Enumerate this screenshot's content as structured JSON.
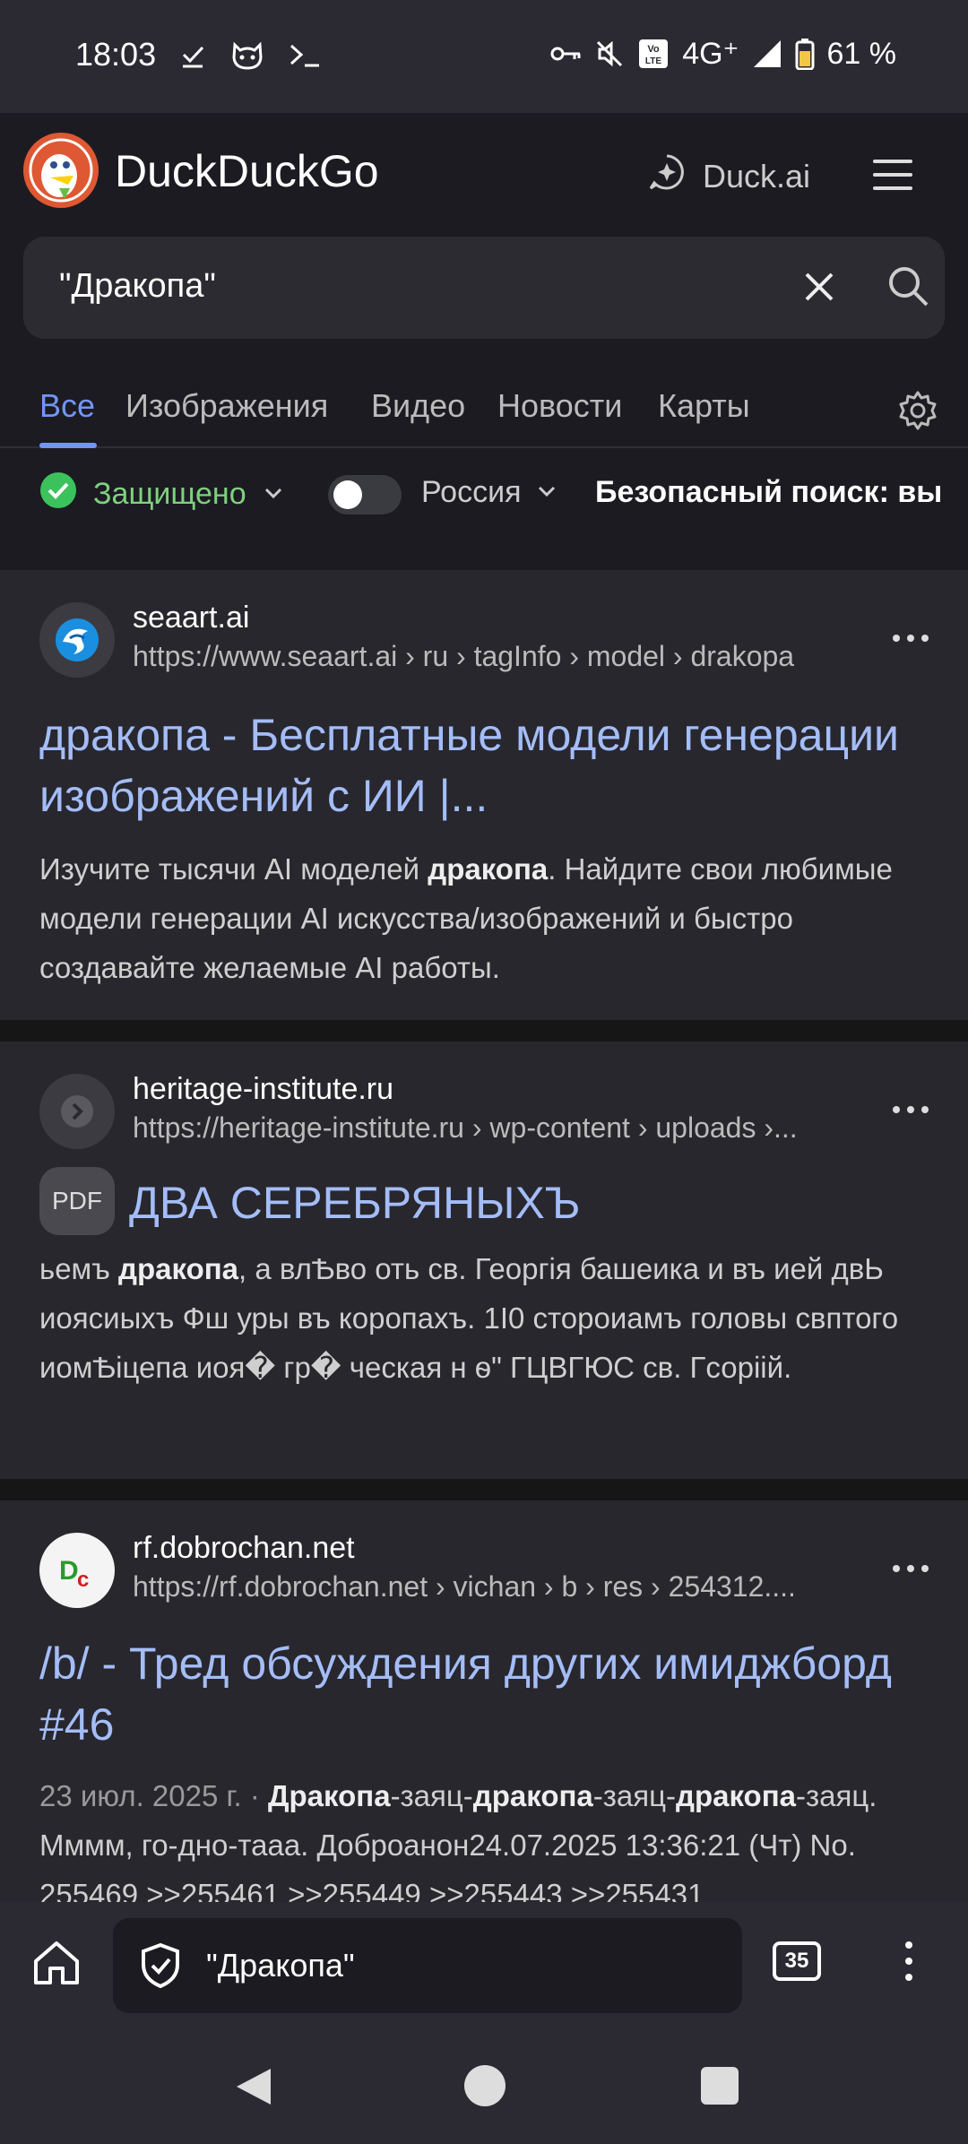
{
  "status_bar": {
    "time": "18:03",
    "network": "4G⁺",
    "battery": "61 %"
  },
  "header": {
    "brand": "DuckDuckGo",
    "duck_ai_label": "Duck.ai",
    "search_query": "\"Дракопа\""
  },
  "tabs": [
    {
      "label": "Все",
      "active": true
    },
    {
      "label": "Изображения"
    },
    {
      "label": "Видео"
    },
    {
      "label": "Новости"
    },
    {
      "label": "Карты"
    }
  ],
  "filters": {
    "protected_label": "Защищено",
    "region_label": "Россия",
    "safe_search_label": "Безопасный поиск: вы"
  },
  "results": [
    {
      "domain": "seaart.ai",
      "url": "https://www.seaart.ai › ru › tagInfo › model › drakopa",
      "title": "дракопа - Бесплатные модели генерации изображений с ИИ |...",
      "snippet_parts": [
        {
          "text": "Изучите тысячи AI моделей ",
          "bold": false
        },
        {
          "text": "дракопа",
          "bold": true
        },
        {
          "text": ". Найдите свои любимые модели генерации AI искусства/изображений и быстро создавайте желаемые AI работы.",
          "bold": false
        }
      ]
    },
    {
      "domain": "heritage-institute.ru",
      "url": "https://heritage-institute.ru › wp-content › uploads ›...",
      "badge": "PDF",
      "title": "ДВА СЕРЕБРЯНЫХЪ",
      "snippet_parts": [
        {
          "text": "ьемъ ",
          "bold": false
        },
        {
          "text": "дракопа",
          "bold": true
        },
        {
          "text": ", а влѢво оть св. Георгія башеика и въ ией двЬ иоясиыхъ Фш уры въ коропахъ. 1І0 стороиамъ головы свптого иомѢіцепа иоя� гр� ческая н ѳ\" ГЦВГЮС св. Гсоріій.",
          "bold": false
        }
      ]
    },
    {
      "domain": "rf.dobrochan.net",
      "url": "https://rf.dobrochan.net › vichan › b › res › 254312....",
      "title": "/b/ - Тред обсуждения других имиджборд #46",
      "date": "23 июл. 2025 г. · ",
      "snippet_parts": [
        {
          "text": "Дракопа",
          "bold": true
        },
        {
          "text": "-заяц-",
          "bold": false
        },
        {
          "text": "дракопа",
          "bold": true
        },
        {
          "text": "-заяц-",
          "bold": false
        },
        {
          "text": "дракопа",
          "bold": true
        },
        {
          "text": "-заяц. Мммм, го-дно-тааа. Доброанон24.07.2025 13:36:21 (Чт) No. 255469 >>255461 >>255449 >>255443 >>255431",
          "bold": false
        }
      ]
    }
  ],
  "bottom_bar": {
    "address_text": "\"Дракопа\"",
    "tab_count": "35"
  }
}
